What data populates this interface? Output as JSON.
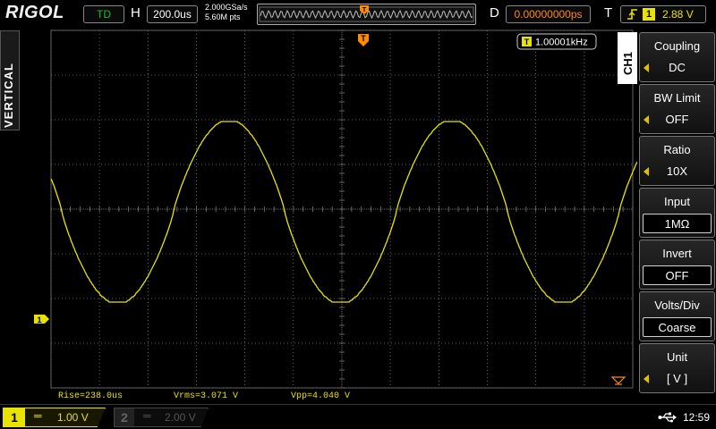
{
  "header": {
    "brand": "RIGOL",
    "run_state": "TD",
    "h_label": "H",
    "timebase": "200.0us",
    "sample_rate": "2.000GSa/s",
    "memory_depth": "5.60M pts",
    "d_label": "D",
    "delay": "0.00000000ps",
    "t_label": "T",
    "trigger_source": "1",
    "trigger_level": "2.88 V"
  },
  "left": {
    "menu_title": "VERTICAL"
  },
  "grid": {
    "freq_readout": "1.00001kHz",
    "trigger_marker_label": "T",
    "channel_ground_marker": "1"
  },
  "menu": {
    "channel_tab": "CH1",
    "items": [
      {
        "title": "Coupling",
        "value": "DC"
      },
      {
        "title": "BW Limit",
        "value": "OFF"
      },
      {
        "title": "Ratio",
        "value": "10X"
      },
      {
        "title": "Input",
        "value": "1MΩ"
      },
      {
        "title": "Invert",
        "value": "OFF"
      },
      {
        "title": "Volts/Div",
        "value": "Coarse"
      },
      {
        "title": "Unit",
        "value": "[ V ]"
      }
    ]
  },
  "measurements": {
    "rise": "Rise=238.0us",
    "vrms": "Vrms=3.071 V",
    "vpp": "Vpp=4.040 V"
  },
  "footer": {
    "ch1_number": "1",
    "ch1_coupling": "═",
    "ch1_scale": "1.00 V",
    "ch2_number": "2",
    "ch2_coupling": "═",
    "ch2_scale": "2.00 V",
    "clock": "12:59"
  },
  "colors": {
    "trace": "#e8e300",
    "trigger": "#ff8c00",
    "grid": "#7a7a7a",
    "run_state": "#19c319"
  }
}
